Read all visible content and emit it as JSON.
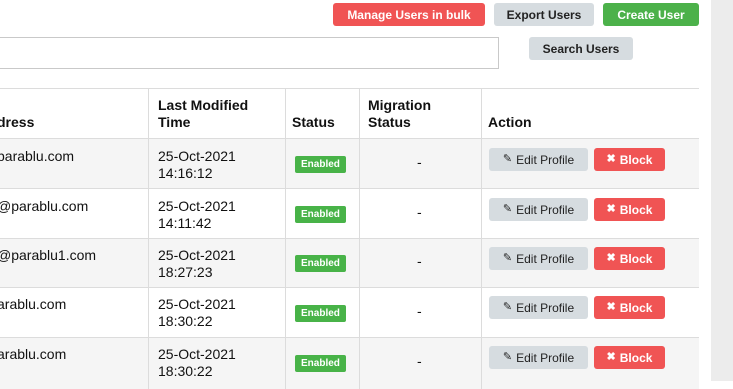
{
  "toolbar": {
    "manage_bulk_label": "Manage Users in bulk",
    "export_label": "Export Users",
    "create_label": "Create User"
  },
  "search": {
    "value": "",
    "placeholder": "",
    "button_label": "Search Users"
  },
  "table": {
    "headers": {
      "address": "dress",
      "modified_line1": "Last Modified",
      "modified_line2": "Time",
      "status": "Status",
      "migration_line1": "Migration",
      "migration_line2": "Status",
      "action": "Action"
    },
    "rows": [
      {
        "email": "parablu.com",
        "date": "25-Oct-2021",
        "time": "14:16:12",
        "status": "Enabled",
        "migration": "-",
        "edit": "Edit Profile",
        "block": "Block"
      },
      {
        "email": "@parablu.com",
        "date": "25-Oct-2021",
        "time": "14:11:42",
        "status": "Enabled",
        "migration": "-",
        "edit": "Edit Profile",
        "block": "Block"
      },
      {
        "email": "@parablu1.com",
        "date": "25-Oct-2021",
        "time": "18:27:23",
        "status": "Enabled",
        "migration": "-",
        "edit": "Edit Profile",
        "block": "Block"
      },
      {
        "email": "arablu.com",
        "date": "25-Oct-2021",
        "time": "18:30:22",
        "status": "Enabled",
        "migration": "-",
        "edit": "Edit Profile",
        "block": "Block"
      },
      {
        "email": "arablu.com",
        "date": "25-Oct-2021",
        "time": "18:30:22",
        "status": "Enabled",
        "migration": "-",
        "edit": "Edit Profile",
        "block": "Block"
      }
    ]
  },
  "colors": {
    "danger": "#f05454",
    "success": "#4cb14a",
    "neutral": "#d6dce0",
    "row_alt": "#f5f5f5"
  },
  "icons": {
    "edit": "edit-icon",
    "block": "user-block-icon"
  }
}
